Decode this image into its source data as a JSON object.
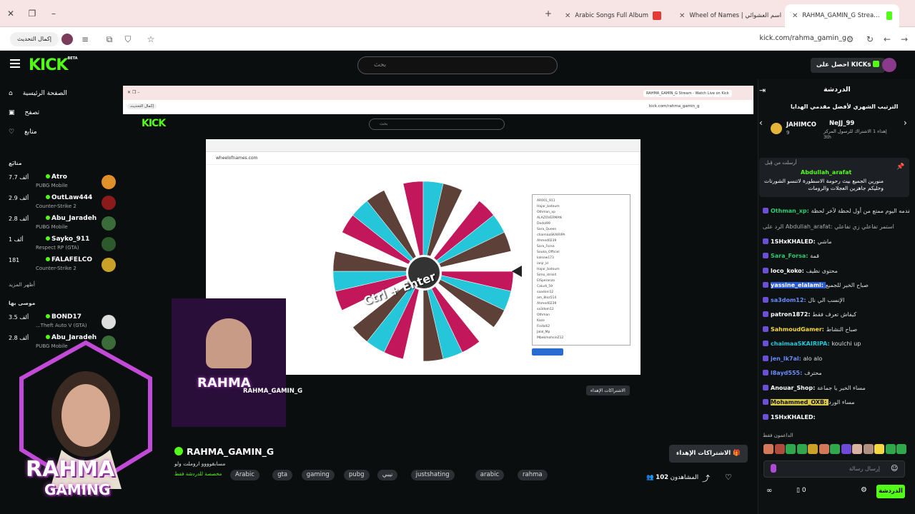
{
  "browser": {
    "tabs": [
      {
        "label": "Arabic Songs Full Album",
        "color": "#e53935"
      },
      {
        "label": "Wheel of Names | اسم العشوائي",
        "color": "#ef6c00"
      },
      {
        "label": "RAHMA_GAMIN_G Stream - Watch Live on Kick",
        "color": "#53fc18"
      }
    ],
    "update_label": "إكمال التحديث",
    "url": "kick.com/rahma_gamin_g"
  },
  "kick": {
    "logo": "KICK",
    "logo_badge": "BETA",
    "search_placeholder": "بحث",
    "get_kicks": "احصل على KICKs"
  },
  "sidebar": {
    "nav": [
      {
        "label": "الصفحة الرئيسية",
        "icon": "home-icon"
      },
      {
        "label": "تصفح",
        "icon": "browse-icon"
      },
      {
        "label": "متابع",
        "icon": "heart-icon"
      }
    ],
    "following_title": "متابَع",
    "following": [
      {
        "viewers": "7.7 ألف",
        "name": "Atro",
        "game": "PUBG Mobile",
        "avatar_color": "#e0902a"
      },
      {
        "viewers": "2.9 ألف",
        "name": "OutLaw444",
        "game": "Counter-Strike 2",
        "avatar_color": "#8b1a1a"
      },
      {
        "viewers": "2.8 ألف",
        "name": "Abu_Jaradeh",
        "game": "PUBG Mobile",
        "avatar_color": "#3a6b3a"
      },
      {
        "viewers": "1 ألف",
        "name": "Sayko_911",
        "game": "Respect RP (GTA)",
        "avatar_color": "#2d5a2d"
      },
      {
        "viewers": "181",
        "name": "FALAFELCO",
        "game": "Counter-Strike 2",
        "avatar_color": "#c9a227"
      }
    ],
    "show_more": "أظهر المزيد",
    "recommended_title": "موصى بها",
    "recommended": [
      {
        "viewers": "3.5 ألف",
        "name": "BOND17",
        "game": "...Theft Auto V (GTA)",
        "avatar_color": "#ddd"
      },
      {
        "viewers": "2.8 ألف",
        "name": "Abu_Jaradeh",
        "game": "PUBG Mobile",
        "avatar_color": "#3a6b3a"
      }
    ]
  },
  "stream": {
    "inner_url": "kick.com/rahma_gamin_g",
    "wheel_url": "wheelofnames.com",
    "wheel_center_text": "Ctrl + Enter",
    "wheel_colors": [
      "#c2185b",
      "#26c6da",
      "#5d4037",
      "#ffffff"
    ],
    "entries": [
      "AR001_911",
      "Hajar_batoum",
      "Othman_xp",
      "ALAZOVERMAN",
      "Dedol99",
      "Sara_Queen",
      "chaimaaSKAIRIPA",
      "Ahmed0239",
      "Sara_Forsa",
      "Souka_Officiel",
      "kalsow173",
      "ianjr_kl",
      "Hajar_batoum",
      "Simo_idrisi4",
      "ElSperanzo",
      "Caludi_59",
      "saadoni12",
      "am_8loz514",
      "Ahmed0239",
      "sa3dom12",
      "Othman",
      "Kaze",
      "Fisdalli2",
      "Jalal_Mp",
      "MbekmohsinZ12"
    ],
    "viewer_count": "102",
    "viewer_label": "المشاهدون",
    "channel_name": "RAHMA_GAMIN_G",
    "channel_sub": "مسابقوووو اروملت ولو",
    "channel_sub2": "مخصصة للدردشة فقط",
    "tags": [
      "Arabic",
      "gta",
      "gaming",
      "pubg",
      "نيبي",
      "justshating",
      "arabic",
      "rahma"
    ],
    "subscribe_gift": "الاشتراكات الإهداء",
    "cam_name_line1": "RAHMA",
    "cam_name_line2": "GAMING"
  },
  "chat": {
    "title": "الدردشة",
    "leaderboard_title": "الترتيب الشهري لأفضل مقدمي الهدايا",
    "leaders": [
      {
        "name": "JAHIMCO",
        "note": "9"
      },
      {
        "name": "NeJJ_99",
        "note": "إهداء 1 الاشتراك للرسول المركز 3th"
      }
    ],
    "pinned_by": "أرسلت من قِبل",
    "pinned_user": "Abdullah_arafat",
    "pinned_text": "منورين الجميع بيث رحومة الاسطورة لاتنسو الشورتات وخليكم جاهزين العجلات والرومات",
    "messages": [
      {
        "user": "Othman_xp",
        "color": "#2ecc71",
        "text": "يا رهيب المحتوى الي تقدمه اليوم ممتع من أول لحظة لآخر لحظة"
      },
      {
        "user": "",
        "color": "#aaa",
        "text": "الرد على Abdullah_arafat: استمر تفاعلي زي تفاعلي"
      },
      {
        "user": "1SHxKHALED",
        "color": "#fff",
        "text": "ماشي"
      },
      {
        "user": "Sara_Forsa",
        "color": "#2ecc71",
        "text": "قمة"
      },
      {
        "user": "loco_koko",
        "color": "#fff",
        "text": "محتوى نظيف"
      },
      {
        "user": "yassine_elalami",
        "color": "#fff",
        "text": "صباح الخير للجميع"
      },
      {
        "user": "sa3dom12",
        "color": "#6b8cff",
        "text": "الإنسب الي نال"
      },
      {
        "user": "patron1872",
        "color": "#fff",
        "text": "كيفاش تعرف فقط"
      },
      {
        "user": "SahmoudGamer",
        "color": "#f5d742",
        "text": "صباح النشاط"
      },
      {
        "user": "chaimaaSKAIRIPA",
        "color": "#26c6da",
        "text": "koulchi up"
      },
      {
        "user": "jen_lk7al",
        "color": "#6b8cff",
        "text": "alo alo"
      },
      {
        "user": "l8ayd555",
        "color": "#6b8cff",
        "text": "محترف"
      },
      {
        "user": "Anouar_Shop",
        "color": "#fff",
        "text": "مساء الخير يا جماعة"
      },
      {
        "user": "Mohammed_OXB",
        "color": "#f5d742",
        "text": "مساء الورد"
      },
      {
        "user": "1SHxKHALED",
        "color": "#fff",
        "text": ""
      }
    ],
    "supporters_label": "الداعمون فقط",
    "input_placeholder": "إرسال رسالة",
    "send_label": "الدردشة",
    "points": "0"
  }
}
